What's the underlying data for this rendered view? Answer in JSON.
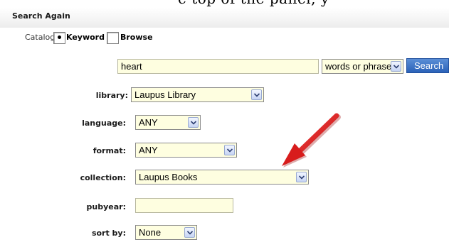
{
  "top_text": "e top of the panel, y",
  "header": {
    "title": "Search Again"
  },
  "catalog": {
    "label": "Catalog",
    "options": [
      {
        "label": "Keyword",
        "selected": true
      },
      {
        "label": "Browse",
        "selected": false
      }
    ]
  },
  "search": {
    "query": "heart",
    "match_type": "words or phrase",
    "button_label": "Search"
  },
  "fields": {
    "library": {
      "label": "library:",
      "value": "Laupus Library"
    },
    "language": {
      "label": "language:",
      "value": "ANY"
    },
    "format": {
      "label": "format:",
      "value": "ANY"
    },
    "collection": {
      "label": "collection:",
      "value": "Laupus Books"
    },
    "pubyear": {
      "label": "pubyear:",
      "value": ""
    },
    "sortby": {
      "label": "sort by:",
      "value": "None"
    }
  },
  "colors": {
    "field_bg": "#fefee0",
    "button_blue": "#2b62b8",
    "annotation_arrow": "#e02020"
  },
  "icons": {
    "dropdown": "chevron-down-icon",
    "annotation": "red-arrow-icon",
    "radio_checked": "radio-dot-icon"
  }
}
